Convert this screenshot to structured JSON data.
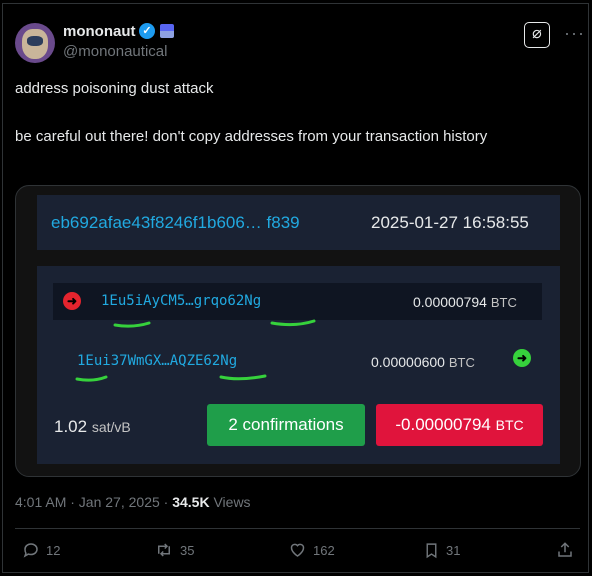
{
  "author": {
    "name": "mononaut",
    "handle": "@mononautical"
  },
  "tweet": {
    "line1": "address poisoning dust attack",
    "line2": "be careful out there! don't copy addresses from your transaction history"
  },
  "transaction": {
    "txid": "eb692afae43f8246f1b606… f839",
    "timestamp": "2025-01-27 16:58:55",
    "input": {
      "address": "1Eu5iAyCM5…grqo62Ng",
      "amount": "0.00000794",
      "unit": "BTC"
    },
    "output": {
      "address": "1Eui37WmGX…AQZE62Ng",
      "amount": "0.00000600",
      "unit": "BTC"
    },
    "fee_rate": "1.02",
    "fee_unit": "sat/vB",
    "confirmations": "2 confirmations",
    "net_amount": "-0.00000794",
    "net_unit": "BTC"
  },
  "meta": {
    "time": "4:01 AM · Jan 27, 2025 · ",
    "views_count": "34.5K",
    "views_label": " Views"
  },
  "actions": {
    "replies": "12",
    "reposts": "35",
    "likes": "162",
    "bookmarks": "31"
  },
  "colors": {
    "link": "#21a9e0",
    "green": "#1f9e4a",
    "red": "#e0143c",
    "highlight": "#36d23c"
  },
  "icons": [
    "verified-icon",
    "grok-icon",
    "more-icon",
    "red-arrow-icon",
    "green-arrow-icon",
    "reply-icon",
    "repost-icon",
    "like-icon",
    "bookmark-icon",
    "share-icon"
  ]
}
